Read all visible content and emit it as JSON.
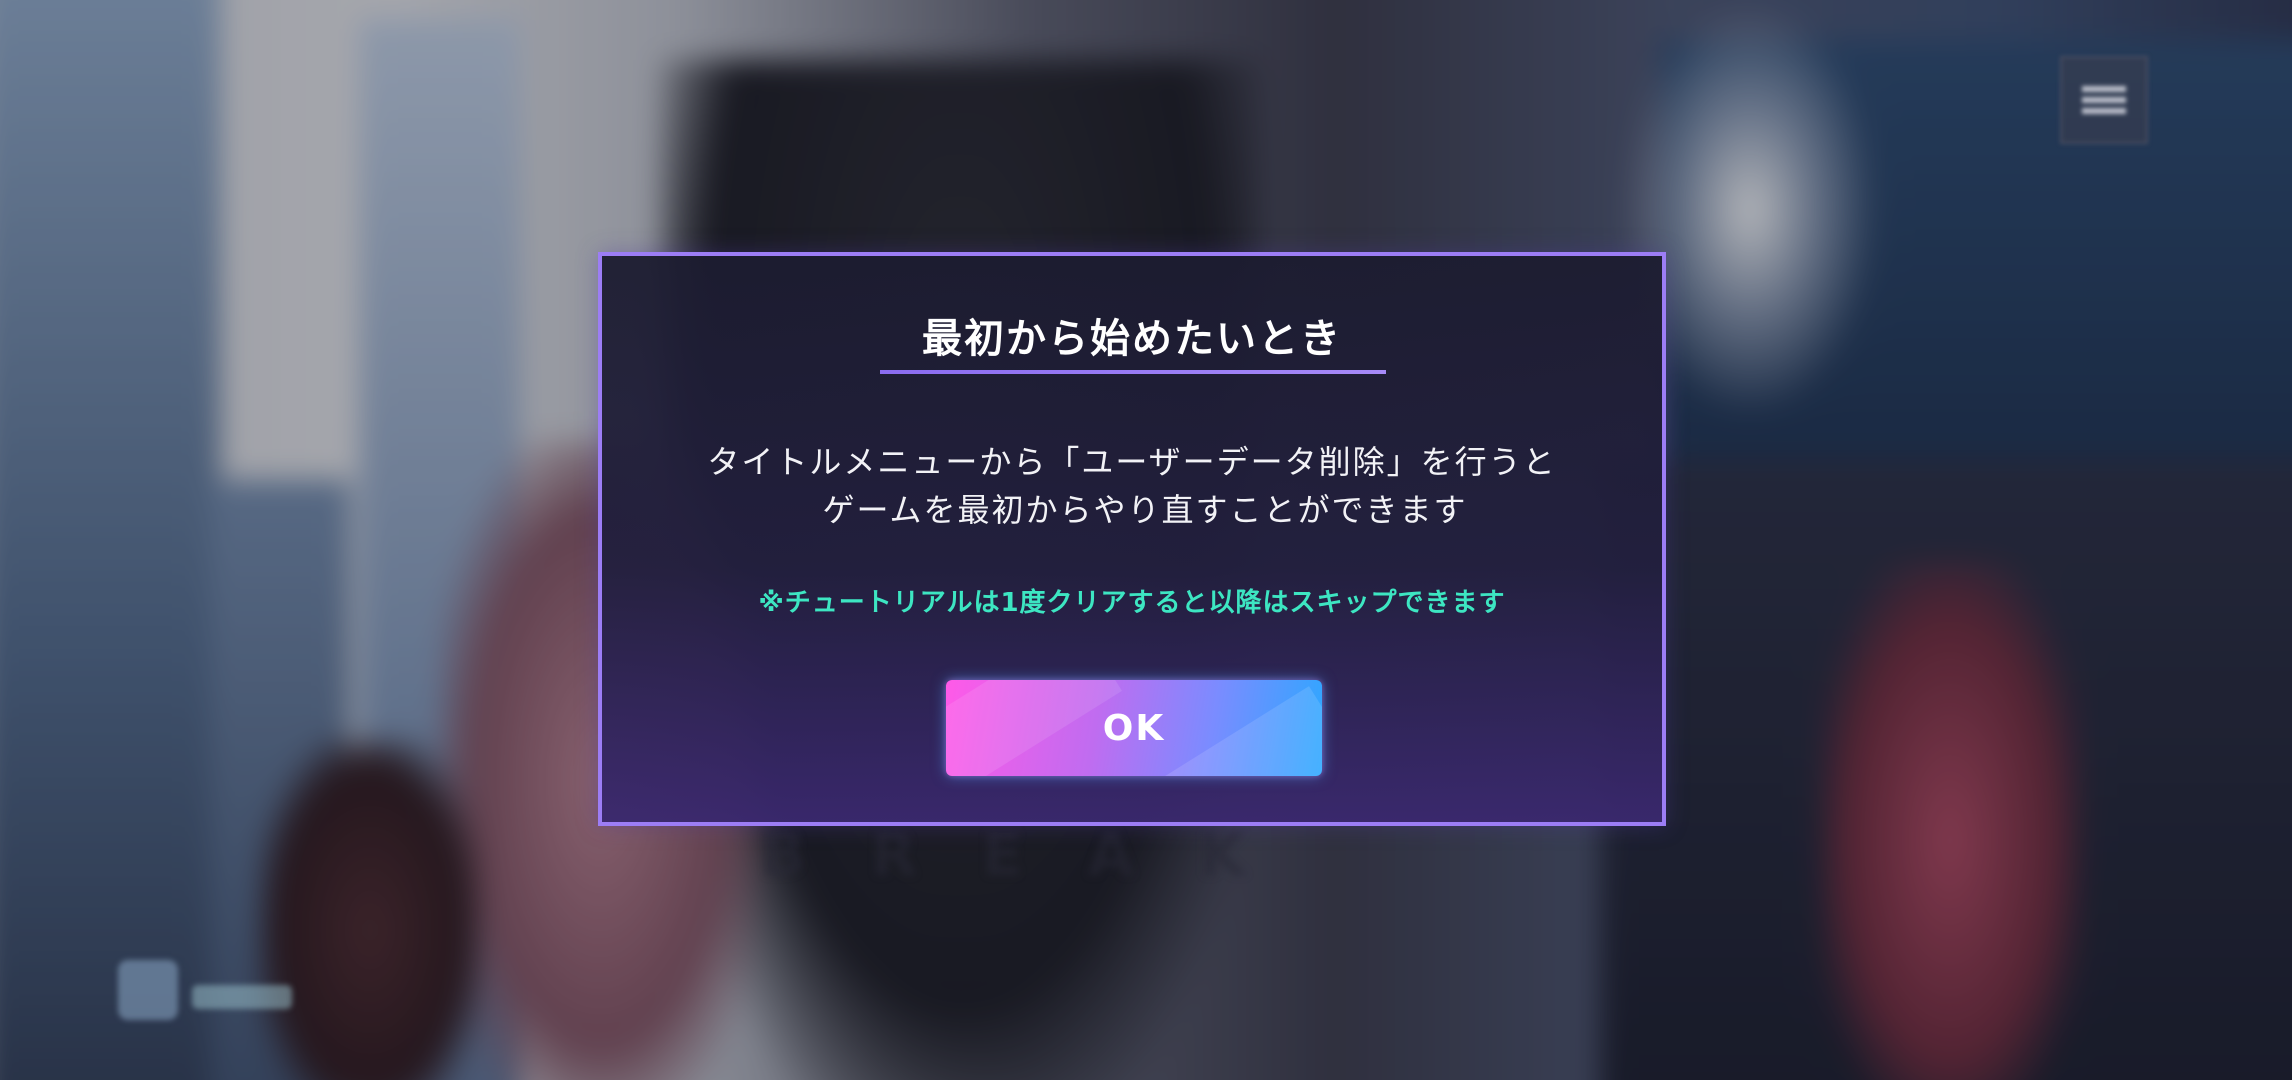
{
  "dialog": {
    "title": "最初から始めたいとき",
    "body_line1": "タイトルメニューから「ユーザーデータ削除」を行うと",
    "body_line2": "ゲームを最初からやり直すことができます",
    "note": "※チュートリアルは1度クリアすると以降はスキップできます",
    "ok_label": "OK"
  },
  "colors": {
    "dialog_border": "#9c7df5",
    "note_text": "#3de6c2",
    "button_gradient_start": "#ff5ae8",
    "button_gradient_end": "#2ba8ff"
  },
  "icons": {
    "corner_button": "menu-icon"
  }
}
